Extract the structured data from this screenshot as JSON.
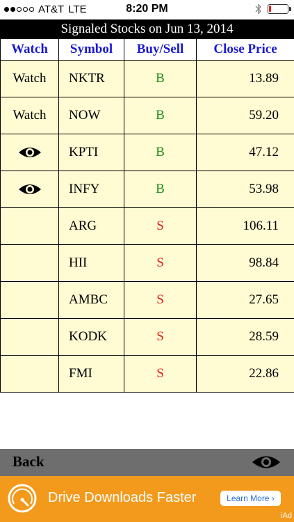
{
  "status_bar": {
    "carrier": "AT&T",
    "network": "LTE",
    "time": "8:20 PM",
    "signal_bars_filled": 2,
    "signal_bars_total": 5,
    "battery_level": 0.12,
    "battery_color": "#e02020",
    "bluetooth_icon": "bluetooth-icon"
  },
  "title": "Signaled Stocks on Jun 13, 2014",
  "table": {
    "headers": [
      "Watch",
      "Symbol",
      "Buy/Sell",
      "Close Price"
    ],
    "rows": [
      {
        "watch": "Watch",
        "watch_icon": false,
        "symbol": "NKTR",
        "signal": "B",
        "price": "13.89"
      },
      {
        "watch": "Watch",
        "watch_icon": false,
        "symbol": "NOW",
        "signal": "B",
        "price": "59.20"
      },
      {
        "watch": "",
        "watch_icon": true,
        "symbol": "KPTI",
        "signal": "B",
        "price": "47.12"
      },
      {
        "watch": "",
        "watch_icon": true,
        "symbol": "INFY",
        "signal": "B",
        "price": "53.98"
      },
      {
        "watch": "",
        "watch_icon": false,
        "symbol": "ARG",
        "signal": "S",
        "price": "106.11"
      },
      {
        "watch": "",
        "watch_icon": false,
        "symbol": "HII",
        "signal": "S",
        "price": "98.84"
      },
      {
        "watch": "",
        "watch_icon": false,
        "symbol": "AMBC",
        "signal": "S",
        "price": "27.65"
      },
      {
        "watch": "",
        "watch_icon": false,
        "symbol": "KODK",
        "signal": "S",
        "price": "28.59"
      },
      {
        "watch": "",
        "watch_icon": false,
        "symbol": "FMI",
        "signal": "S",
        "price": "22.86"
      }
    ]
  },
  "colors": {
    "header_text": "#1a1ad0",
    "row_background": "#fffbd2",
    "buy": "#1d8c1d",
    "sell": "#e81c1c",
    "bottom_bar": "#6e6e6e",
    "ad_background": "#f39a1c"
  },
  "bottom_bar": {
    "back_label": "Back",
    "eye_icon": "eye-icon"
  },
  "ad": {
    "icon": "speedometer-icon",
    "text": "Drive Downloads Faster",
    "cta": "Learn More ›",
    "badge": "iAd"
  }
}
